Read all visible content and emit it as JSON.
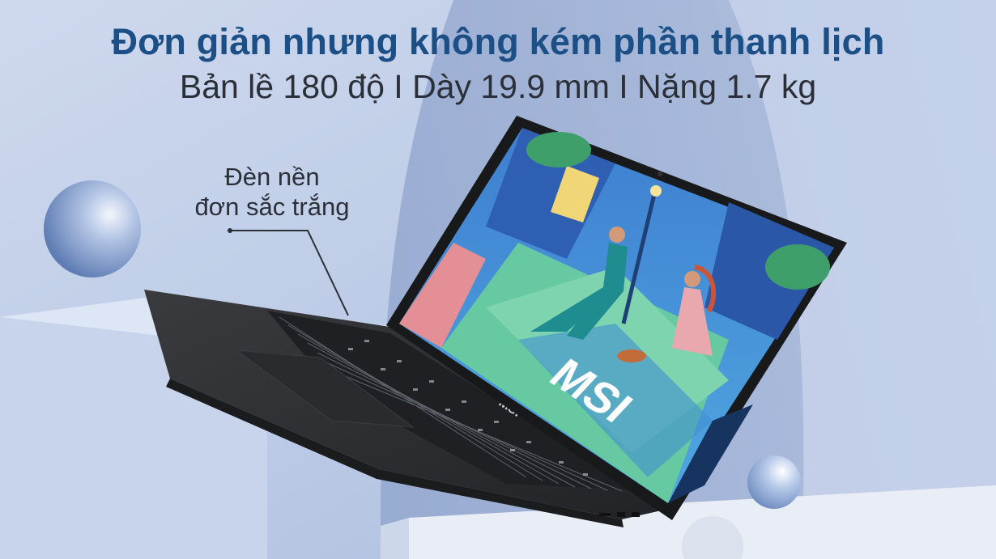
{
  "headline": {
    "title": "Đơn giản nhưng không kém phần thanh lịch",
    "subtitle": "Bản lề 180 độ I Dày 19.9 mm I Nặng 1.7 kg"
  },
  "callout": {
    "line1": "Đèn nền",
    "line2": "đơn sắc trắng"
  },
  "laptop": {
    "brand_logo": "MSI"
  },
  "colors": {
    "title": "#1c4f86",
    "subtitle": "#2b2f38",
    "background": "#b9c8e4",
    "laptop_body": "#2f3033",
    "screen_sky": "#3e9ad6"
  }
}
